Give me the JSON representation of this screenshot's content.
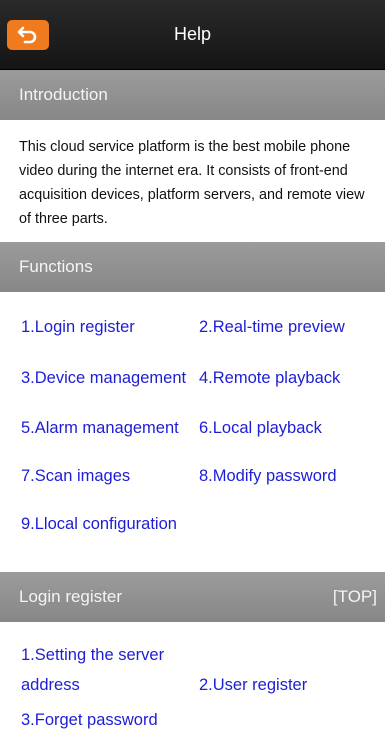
{
  "header": {
    "title": "Help"
  },
  "introduction": {
    "heading": "Introduction",
    "body": "This cloud service platform is the best mobile phone video during the internet era. It consists of front-end acquisition devices, platform servers, and remote view of three parts."
  },
  "functions": {
    "heading": "Functions",
    "links": [
      "1.Login register",
      "2.Real-time preview",
      "3.Device management",
      "4.Remote playback",
      "5.Alarm management",
      "6.Local playback",
      "7.Scan images",
      "8.Modify password",
      "9.Llocal configuration"
    ]
  },
  "login_register": {
    "heading": "Login register",
    "top_label": "[TOP]",
    "links": [
      "1.Setting the server address",
      "2.User register",
      "3.Forget password"
    ]
  },
  "colors": {
    "back_button": "#f07b1e",
    "header_bg": "#1f1f1f",
    "section_bg": "#8f8f8f",
    "link": "#1d1dd6"
  },
  "icons": {
    "back": "back-arrow-icon"
  }
}
